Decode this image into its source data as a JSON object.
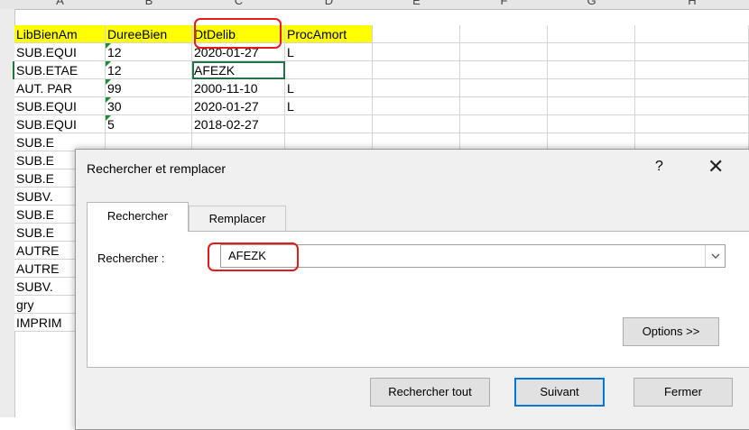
{
  "spreadsheet": {
    "columns": [
      "A",
      "B",
      "C",
      "D",
      "E",
      "F",
      "G",
      "H"
    ],
    "header_row": [
      "LibBienAm",
      "DureeBien",
      "DtDelib",
      "ProcAmort"
    ],
    "rows": [
      {
        "a": "SUB.EQUI",
        "b": "12",
        "c": "2020-01-27",
        "d": "L"
      },
      {
        "a": "SUB.ETAE",
        "b": "12",
        "c": "AFEZK",
        "d": ""
      },
      {
        "a": "AUT. PAR",
        "b": "99",
        "c": "2000-11-10",
        "d": "L"
      },
      {
        "a": "SUB.EQUI",
        "b": "30",
        "c": "2020-01-27",
        "d": "L"
      },
      {
        "a": "SUB.EQUI",
        "b": "5",
        "c": "2018-02-27",
        "d": ""
      },
      {
        "a": "SUB.E",
        "b": "",
        "c": "",
        "d": ""
      },
      {
        "a": "SUB.E",
        "b": "",
        "c": "",
        "d": ""
      },
      {
        "a": "SUB.E",
        "b": "",
        "c": "",
        "d": ""
      },
      {
        "a": "SUBV.",
        "b": "",
        "c": "",
        "d": ""
      },
      {
        "a": "SUB.E",
        "b": "",
        "c": "",
        "d": ""
      },
      {
        "a": "SUB.E",
        "b": "",
        "c": "",
        "d": ""
      },
      {
        "a": "AUTRE",
        "b": "",
        "c": "",
        "d": ""
      },
      {
        "a": "AUTRE",
        "b": "",
        "c": "",
        "d": ""
      },
      {
        "a": "SUBV.",
        "b": "",
        "c": "",
        "d": ""
      },
      {
        "a": "gry",
        "b": "",
        "c": "",
        "d": ""
      },
      {
        "a": "IMPRIM",
        "b": "",
        "c": "",
        "d": ""
      }
    ]
  },
  "dialog": {
    "title": "Rechercher et remplacer",
    "help": "?",
    "close": "✕",
    "tabs": [
      "Rechercher",
      "Remplacer"
    ],
    "find_label": "Rechercher :",
    "find_value": "AFEZK",
    "options_button": "Options >>",
    "find_all_button": "Rechercher tout",
    "find_next_button": "Suivant",
    "close_button": "Fermer"
  },
  "colors": {
    "highlight": "#ffff00",
    "annotation": "#e21b1b",
    "selection": "#217346",
    "default_button": "#0078d7"
  }
}
